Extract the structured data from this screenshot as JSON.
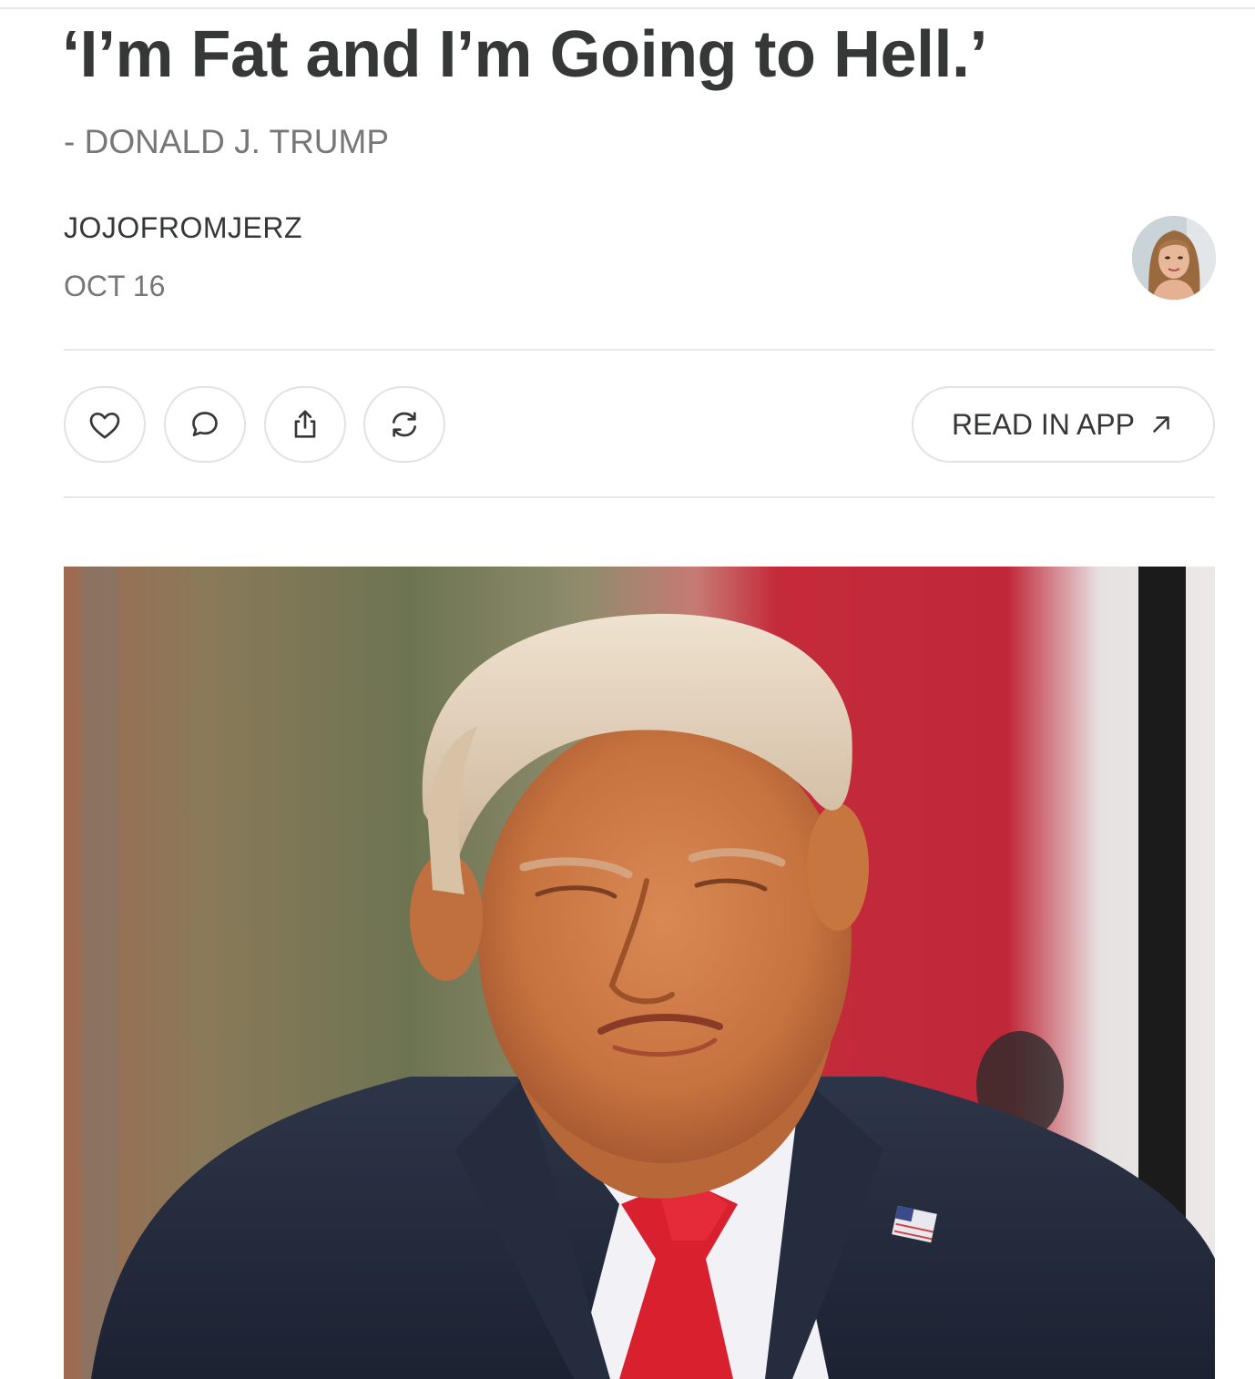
{
  "post": {
    "title": "‘I’m Fat and I’m Going to Hell.’",
    "subtitle": "- DONALD J. TRUMP",
    "author": "JOJOFROMJERZ",
    "date": "OCT 16"
  },
  "actions": {
    "like_icon": "heart-icon",
    "comment_icon": "comment-icon",
    "share_icon": "share-icon",
    "restack_icon": "restack-icon",
    "read_in_app_label": "READ IN APP",
    "read_in_app_icon": "arrow-up-right-icon"
  },
  "colors": {
    "text": "#363737",
    "muted": "#777777",
    "border": "#e2e2e2"
  }
}
